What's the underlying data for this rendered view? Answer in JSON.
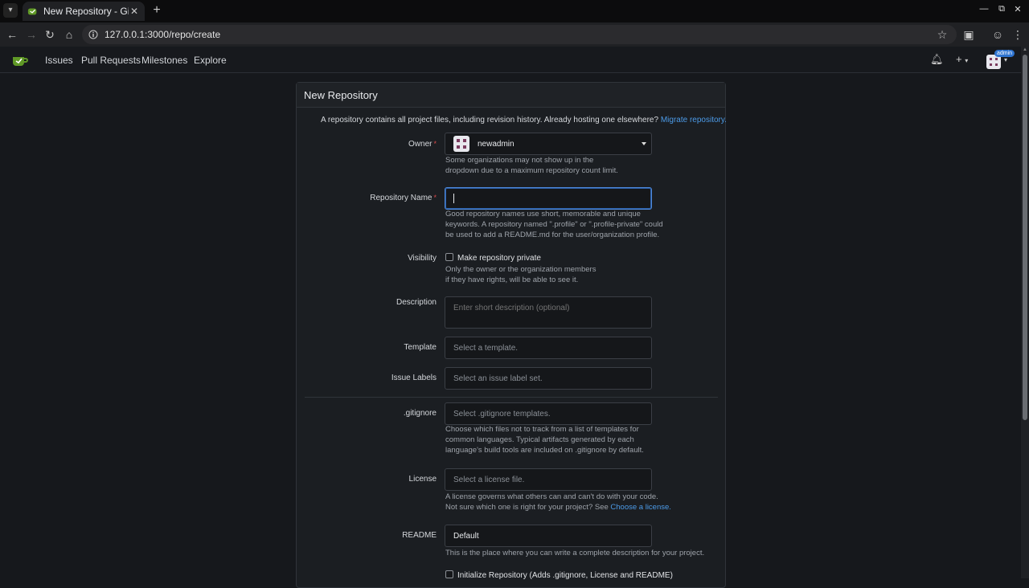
{
  "browser": {
    "tab_title": "New Repository - Gitea",
    "url": "127.0.0.1:3000/repo/create"
  },
  "nav": {
    "items": [
      "Issues",
      "Pull Requests",
      "Milestones",
      "Explore"
    ],
    "avatar_badge": "admin"
  },
  "form": {
    "header": "New Repository",
    "intro_text": "A repository contains all project files, including revision history. Already hosting one elsewhere?",
    "intro_link": "Migrate repository.",
    "owner": {
      "label": "Owner",
      "value": "newadmin",
      "help_line1": "Some organizations may not show up in the",
      "help_line2": "dropdown due to a maximum repository count limit."
    },
    "repo_name": {
      "label": "Repository Name",
      "value": "",
      "help_line1": "Good repository names use short, memorable and unique",
      "help_line2": "keywords. A repository named \".profile\" or \".profile-private\" could",
      "help_line3": "be used to add a README.md for the user/organization profile."
    },
    "visibility": {
      "label": "Visibility",
      "checkbox_label": "Make repository private",
      "help_line1": "Only the owner or the organization members",
      "help_line2": "if they have rights, will be able to see it."
    },
    "description": {
      "label": "Description",
      "placeholder": "Enter short description (optional)"
    },
    "template": {
      "label": "Template",
      "placeholder": "Select a template."
    },
    "issue_labels": {
      "label": "Issue Labels",
      "placeholder": "Select an issue label set."
    },
    "gitignore": {
      "label": ".gitignore",
      "placeholder": "Select .gitignore templates.",
      "help_line1": "Choose which files not to track from a list of templates for",
      "help_line2": "common languages. Typical artifacts generated by each",
      "help_line3": "language's build tools are included on .gitignore by default."
    },
    "license": {
      "label": "License",
      "placeholder": "Select a license file.",
      "help_line1": "A license governs what others can and can't do with your code.",
      "help_line2_prefix": "Not sure which one is right for your project? See",
      "help_link": "Choose a license."
    },
    "readme": {
      "label": "README",
      "value": "Default",
      "help_line1": "This is the place where you can write a complete description for your project."
    },
    "init_checkbox_label": "Initialize Repository (Adds .gitignore, License and README)"
  },
  "colors": {
    "accent": "#4c9be8",
    "focus": "#4e88d8",
    "required": "#db4b4b"
  }
}
